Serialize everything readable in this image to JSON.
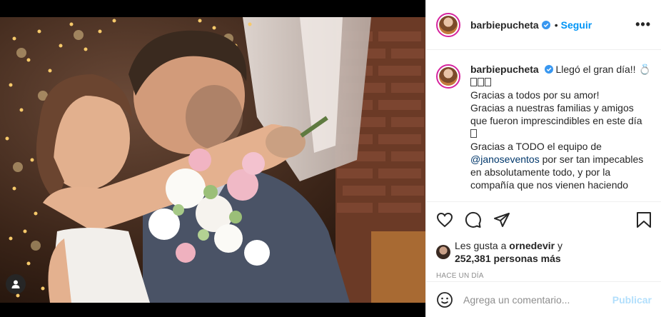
{
  "post": {
    "username": "barbiepucheta",
    "follow_label": "Seguir",
    "separator": "•",
    "more_label": "•••"
  },
  "caption": {
    "username": "barbiepucheta",
    "line1": "Llegó el gran día!!",
    "emoji_ring": "💍",
    "line2": "Gracias a todos por su amor!",
    "line3": "Gracias a nuestras familias y amigos que fueron imprescindibles en este día",
    "line4_pre": "Gracias a TODO el equipo de",
    "mention": "@janoseventos",
    "line4_post": "por ser tan impecables en absolutamente todo, y por la compañía que nos vienen haciendo"
  },
  "likes": {
    "prefix": "Les gusta a",
    "liker": "ornedevir",
    "conj": "y",
    "count": "252,381 personas más"
  },
  "time": "HACE UN DÍA",
  "comment": {
    "placeholder": "Agrega un comentario...",
    "publish_label": "Publicar"
  },
  "colors": {
    "link_blue": "#0095f6",
    "publish_disabled": "#b2dffc",
    "meta_gray": "#8e8e8e",
    "mention": "#00376b"
  },
  "icons": [
    "user-tag-icon",
    "verified-badge-icon",
    "heart-icon",
    "comment-icon",
    "share-icon",
    "bookmark-icon",
    "emoji-icon"
  ]
}
